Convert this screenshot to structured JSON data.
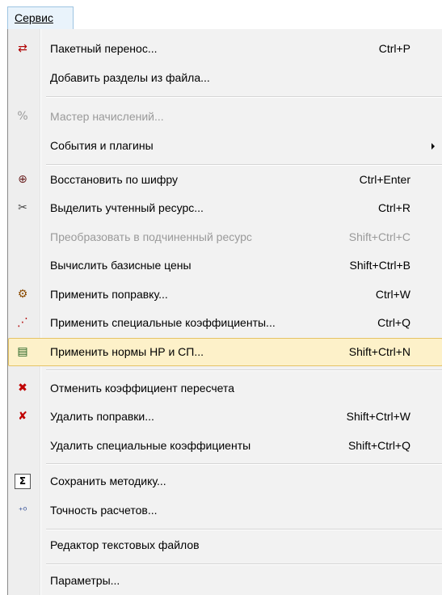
{
  "menubar": {
    "title": "Сервис"
  },
  "items": [
    {
      "id": "batch-transfer",
      "icon": "batch-transfer-icon",
      "glyph": "⇄",
      "color": "#b00000",
      "label": "Пакетный перенос...",
      "shortcut": "Ctrl+P"
    },
    {
      "id": "add-sections",
      "icon": "",
      "glyph": "",
      "label": "Добавить разделы из файла...",
      "shortcut": ""
    },
    {
      "id": "charges-wizard",
      "icon": "percent-icon",
      "glyph": "%",
      "color": "#9a9a9a",
      "label": "Мастер начислений...",
      "shortcut": "",
      "disabled": true
    },
    {
      "id": "events-plugins",
      "icon": "",
      "glyph": "",
      "label": "События и плагины",
      "shortcut": "",
      "submenu": true
    },
    {
      "id": "restore-by-code",
      "icon": "binoculars-icon",
      "glyph": "⊕",
      "color": "#6a2020",
      "label": "Восстановить по шифру",
      "shortcut": "Ctrl+Enter"
    },
    {
      "id": "select-resource",
      "icon": "tools-icon",
      "glyph": "✂",
      "color": "#444444",
      "label": "Выделить учтенный ресурс...",
      "shortcut": "Ctrl+R"
    },
    {
      "id": "convert-subresource",
      "icon": "",
      "glyph": "",
      "label": "Преобразовать в подчиненный ресурс",
      "shortcut": "Shift+Ctrl+C",
      "disabled": true
    },
    {
      "id": "calc-base-prices",
      "icon": "",
      "glyph": "",
      "label": "Вычислить базисные цены",
      "shortcut": "Shift+Ctrl+B"
    },
    {
      "id": "apply-correction",
      "icon": "correction-icon",
      "glyph": "⚙",
      "color": "#8a4a00",
      "label": "Применить поправку...",
      "shortcut": "Ctrl+W"
    },
    {
      "id": "apply-special-coef",
      "icon": "chart-icon",
      "glyph": "⋰",
      "color": "#b00000",
      "label": "Применить специальные коэффициенты...",
      "shortcut": "Ctrl+Q"
    },
    {
      "id": "apply-norms",
      "icon": "norms-icon",
      "glyph": "▤",
      "color": "#206020",
      "label": "Применить нормы НР и СП...",
      "shortcut": "Shift+Ctrl+N",
      "highlight": true
    },
    {
      "id": "cancel-recalc-coef",
      "icon": "cancel-coef-icon",
      "glyph": "✖",
      "color": "#c00000",
      "label": "Отменить коэффициент пересчета",
      "shortcut": ""
    },
    {
      "id": "delete-corrections",
      "icon": "delete-corrections-icon",
      "glyph": "✘",
      "color": "#c00000",
      "label": "Удалить поправки...",
      "shortcut": "Shift+Ctrl+W"
    },
    {
      "id": "delete-special-coef",
      "icon": "",
      "glyph": "",
      "label": "Удалить специальные коэффициенты",
      "shortcut": "Shift+Ctrl+Q"
    },
    {
      "id": "save-method",
      "icon": "sigma-icon",
      "glyph": "Σ",
      "color": "#000000",
      "label": "Сохранить методику...",
      "shortcut": ""
    },
    {
      "id": "calc-precision",
      "icon": "precision-icon",
      "glyph": "⁺⁰",
      "color": "#1a3a8a",
      "label": "Точность расчетов...",
      "shortcut": ""
    },
    {
      "id": "text-editor",
      "icon": "",
      "glyph": "",
      "label": "Редактор текстовых файлов",
      "shortcut": ""
    },
    {
      "id": "parameters",
      "icon": "",
      "glyph": "",
      "label": "Параметры...",
      "shortcut": ""
    }
  ]
}
